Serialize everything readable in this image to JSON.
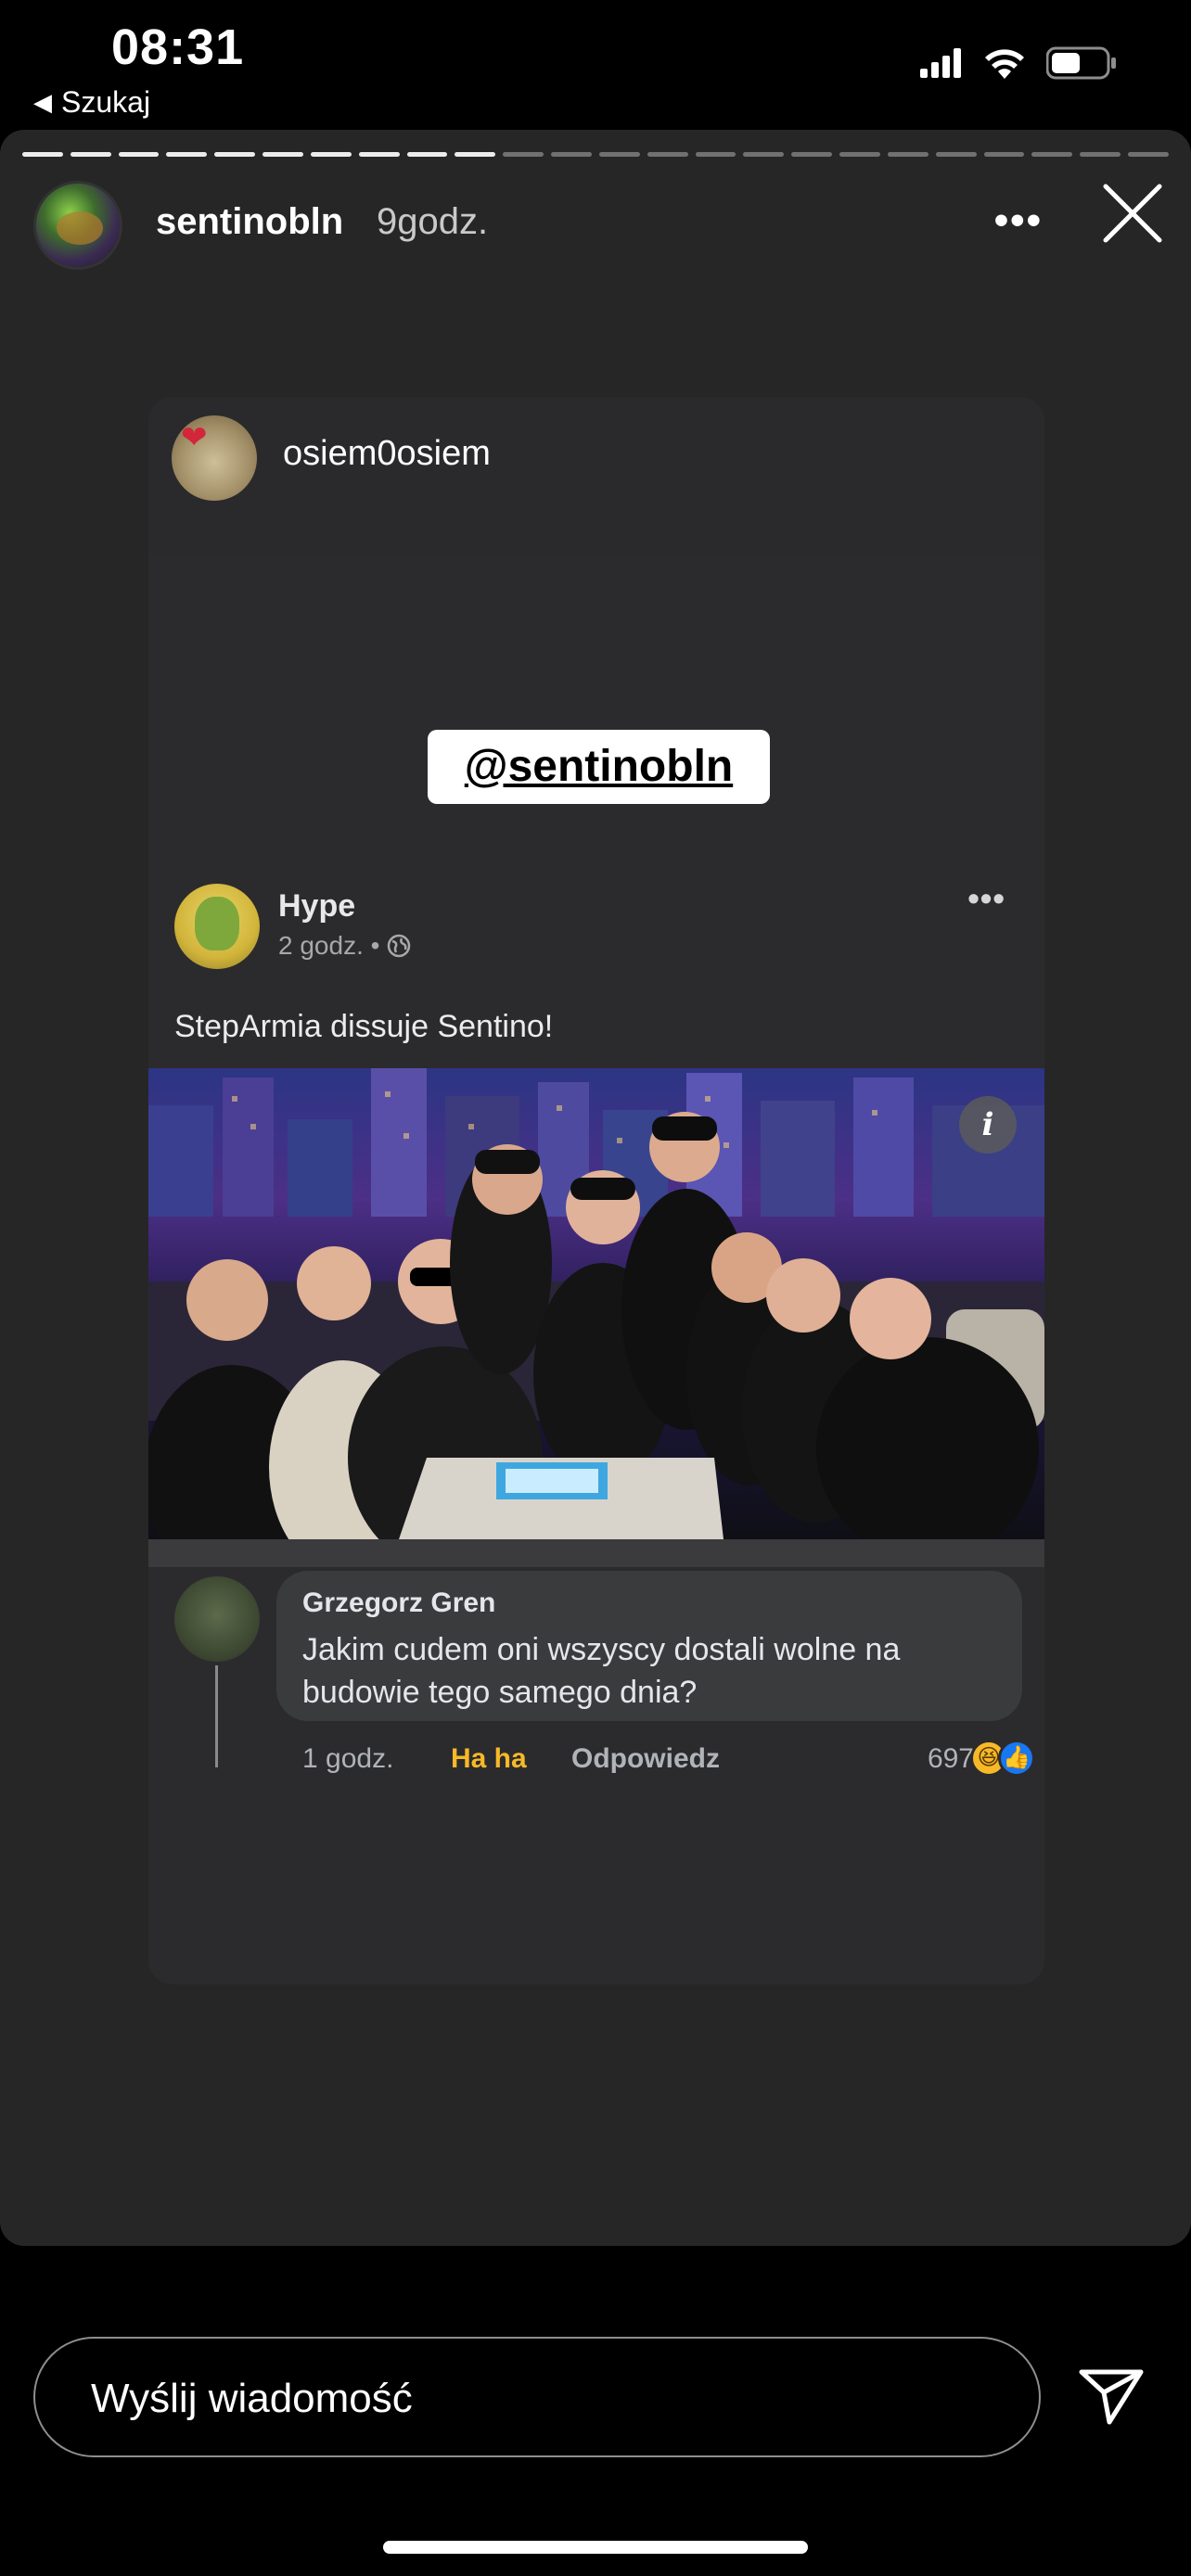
{
  "status_bar": {
    "time": "08:31",
    "back_label": "Szukaj",
    "icons": [
      "signal-icon",
      "wifi-icon",
      "battery-icon"
    ]
  },
  "story": {
    "progress_segments_total": 24,
    "progress_segments_done": 10,
    "username": "sentinobln",
    "time_ago": "9godz.",
    "more_icon": "more-dots-icon",
    "close_icon": "close-icon"
  },
  "shared_post": {
    "username": "osiem0osiem",
    "mention_sticker": "@sentinobln",
    "fb_post": {
      "author": "Hype",
      "time": "2 godz. •",
      "privacy_icon": "globe-icon",
      "text": "StepArmia dissuje Sentino!",
      "photo_icon": "info-icon"
    },
    "comment": {
      "author": "Grzegorz Gren",
      "text": "Jakim cudem oni wszyscy dostali wolne na budowie tego samego dnia?",
      "time": "1 godz.",
      "reaction_label": "Ha ha",
      "reply_label": "Odpowiedz",
      "reaction_count": "697",
      "reaction_icons": [
        "haha-icon",
        "like-icon"
      ]
    }
  },
  "reply_bar": {
    "placeholder": "Wyślij wiadomość",
    "send_icon": "send-icon"
  },
  "colors": {
    "story_bg": "#262626",
    "card_bg": "#2b2b2d",
    "comment_bubble": "#3a3b3c",
    "haha_yellow": "#f7b928",
    "like_blue": "#1877f2"
  }
}
